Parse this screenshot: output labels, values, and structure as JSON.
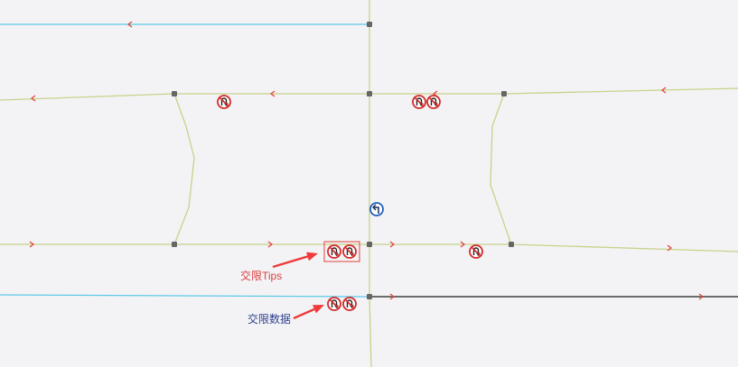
{
  "annotations": {
    "tips_label": "交限Tips",
    "data_label": "交限数据"
  },
  "colors": {
    "background": "#f3f3f5",
    "road": "#c9d18a",
    "blue_road": "#5ec9e8",
    "gray_road": "#6b6b6b",
    "direction_arrow": "#e0403a",
    "node": "#666666",
    "no_uturn_ring": "#d42a2a",
    "left_turn_ring": "#1f5fc2",
    "annotation_arrow": "#ef3b3b",
    "tips_text": "#d94141",
    "data_text": "#2d3f8f"
  },
  "icons": {
    "no_uturn": "no-u-turn-icon",
    "left_turn": "left-turn-icon",
    "junction": "junction-node-icon",
    "direction": "direction-arrow-icon"
  }
}
